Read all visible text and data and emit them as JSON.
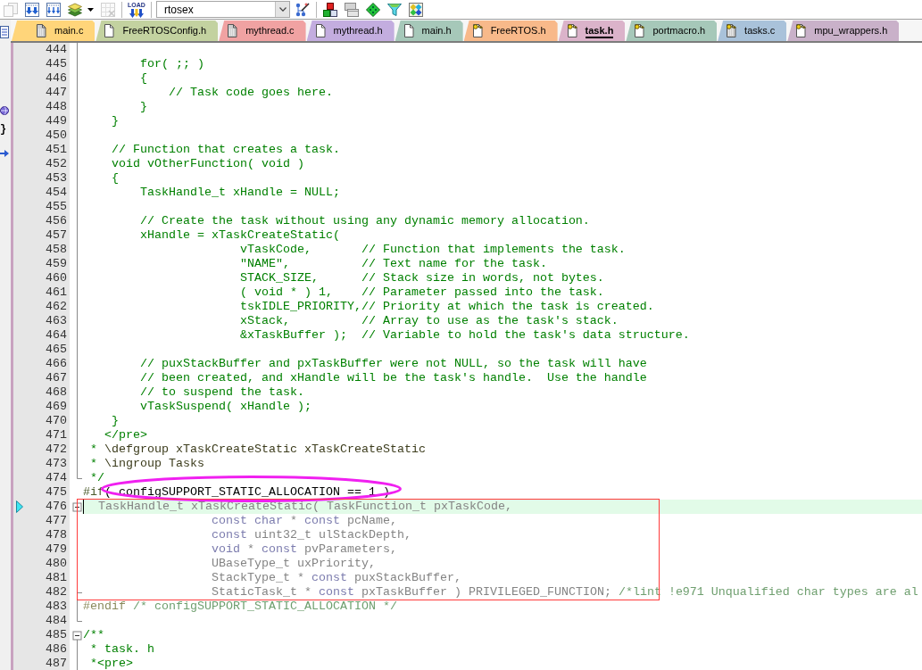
{
  "toolbar": [
    {
      "kind": "pages",
      "disabled": true
    },
    {
      "kind": "download",
      "disabled": false
    },
    {
      "kind": "download_all",
      "disabled": false
    },
    {
      "kind": "layers",
      "disabled": false
    },
    {
      "kind": "caret",
      "disabled": false
    },
    {
      "kind": "grid",
      "disabled": true
    },
    {
      "kind": "separator"
    },
    {
      "kind": "load",
      "label": "LOAD",
      "disabled": false
    },
    {
      "kind": "separator"
    },
    {
      "kind": "combo",
      "value": "rtosex"
    },
    {
      "kind": "wand",
      "disabled": false
    },
    {
      "kind": "separator"
    },
    {
      "kind": "blocks",
      "disabled": false
    },
    {
      "kind": "windows",
      "disabled": false
    },
    {
      "kind": "diamond",
      "disabled": false
    },
    {
      "kind": "funnel",
      "disabled": false
    },
    {
      "kind": "gems",
      "disabled": false
    }
  ],
  "side_toolbar": [
    {
      "kind": "window"
    },
    {
      "kind": "globe"
    },
    {
      "kind": "text",
      "label": "}"
    },
    {
      "kind": "arrow"
    }
  ],
  "tabs": [
    {
      "label": "main.c",
      "kind": "source",
      "read_only": false,
      "color": "#ffd57a",
      "selected": false
    },
    {
      "label": "FreeRTOSConfig.h",
      "kind": "header",
      "read_only": false,
      "color": "#c3d2a0",
      "selected": false
    },
    {
      "label": "mythread.c",
      "kind": "source",
      "read_only": false,
      "color": "#f0a2a2",
      "selected": false
    },
    {
      "label": "mythread.h",
      "kind": "header",
      "read_only": false,
      "color": "#c3addf",
      "selected": false
    },
    {
      "label": "main.h",
      "kind": "header",
      "read_only": false,
      "color": "#a6c8b9",
      "selected": false
    },
    {
      "label": "FreeRTOS.h",
      "kind": "header",
      "read_only": true,
      "color": "#f8b98a",
      "selected": false
    },
    {
      "label": "task.h",
      "kind": "header",
      "read_only": true,
      "color": "#dbb3ca",
      "selected": true
    },
    {
      "label": "portmacro.h",
      "kind": "header",
      "read_only": true,
      "color": "#a6c8b9",
      "selected": false
    },
    {
      "label": "tasks.c",
      "kind": "source",
      "read_only": true,
      "color": "#a9c2da",
      "selected": false
    },
    {
      "label": "mpu_wrappers.h",
      "kind": "header",
      "read_only": true,
      "color": "#c9b1c9",
      "selected": false
    }
  ],
  "lines": [
    {
      "number": "444",
      "current": false,
      "marker": false,
      "fold": {
        "kind": "body"
      }
    },
    {
      "number": "445",
      "current": false,
      "marker": false,
      "fold": {
        "kind": "body"
      },
      "parts": [
        {
          "text": "        for( ;; )",
          "kind": "comment"
        }
      ]
    },
    {
      "number": "446",
      "current": false,
      "marker": false,
      "fold": {
        "kind": "body"
      },
      "parts": [
        {
          "text": "        {",
          "kind": "comment"
        }
      ]
    },
    {
      "number": "447",
      "current": false,
      "marker": false,
      "fold": {
        "kind": "body"
      },
      "parts": [
        {
          "text": "            // Task code goes here.",
          "kind": "comment"
        }
      ]
    },
    {
      "number": "448",
      "current": false,
      "marker": false,
      "fold": {
        "kind": "body"
      },
      "parts": [
        {
          "text": "        }",
          "kind": "comment"
        }
      ]
    },
    {
      "number": "449",
      "current": false,
      "marker": false,
      "fold": {
        "kind": "body"
      },
      "parts": [
        {
          "text": "    }",
          "kind": "comment"
        }
      ]
    },
    {
      "number": "450",
      "current": false,
      "marker": false,
      "fold": {
        "kind": "body"
      }
    },
    {
      "number": "451",
      "current": false,
      "marker": false,
      "fold": {
        "kind": "body"
      },
      "parts": [
        {
          "text": "    // Function that creates a task.",
          "kind": "comment"
        }
      ]
    },
    {
      "number": "452",
      "current": false,
      "marker": false,
      "fold": {
        "kind": "body"
      },
      "parts": [
        {
          "text": "    void vOtherFunction( void )",
          "kind": "comment"
        }
      ]
    },
    {
      "number": "453",
      "current": false,
      "marker": false,
      "fold": {
        "kind": "body"
      },
      "parts": [
        {
          "text": "    {",
          "kind": "comment"
        }
      ]
    },
    {
      "number": "454",
      "current": false,
      "marker": false,
      "fold": {
        "kind": "body"
      },
      "parts": [
        {
          "text": "        TaskHandle_t xHandle = NULL;",
          "kind": "comment"
        }
      ]
    },
    {
      "number": "455",
      "current": false,
      "marker": false,
      "fold": {
        "kind": "body"
      }
    },
    {
      "number": "456",
      "current": false,
      "marker": false,
      "fold": {
        "kind": "body"
      },
      "parts": [
        {
          "text": "        // Create the task without using any dynamic memory allocation.",
          "kind": "comment"
        }
      ]
    },
    {
      "number": "457",
      "current": false,
      "marker": false,
      "fold": {
        "kind": "body"
      },
      "parts": [
        {
          "text": "        xHandle = xTaskCreateStatic(",
          "kind": "comment"
        }
      ]
    },
    {
      "number": "458",
      "current": false,
      "marker": false,
      "fold": {
        "kind": "body"
      },
      "parts": [
        {
          "text": "                      vTaskCode,       // Function that implements the task.",
          "kind": "comment"
        }
      ]
    },
    {
      "number": "459",
      "current": false,
      "marker": false,
      "fold": {
        "kind": "body"
      },
      "parts": [
        {
          "text": "                      \"NAME\",          // Text name for the task.",
          "kind": "comment"
        }
      ]
    },
    {
      "number": "460",
      "current": false,
      "marker": false,
      "fold": {
        "kind": "body"
      },
      "parts": [
        {
          "text": "                      STACK_SIZE,      // Stack size in words, not bytes.",
          "kind": "comment"
        }
      ]
    },
    {
      "number": "461",
      "current": false,
      "marker": false,
      "fold": {
        "kind": "body"
      },
      "parts": [
        {
          "text": "                      ( void * ) 1,    // Parameter passed into the task.",
          "kind": "comment"
        }
      ]
    },
    {
      "number": "462",
      "current": false,
      "marker": false,
      "fold": {
        "kind": "body"
      },
      "parts": [
        {
          "text": "                      tskIDLE_PRIORITY,// Priority at which the task is created.",
          "kind": "comment"
        }
      ]
    },
    {
      "number": "463",
      "current": false,
      "marker": false,
      "fold": {
        "kind": "body"
      },
      "parts": [
        {
          "text": "                      xStack,          // Array to use as the task's stack.",
          "kind": "comment"
        }
      ]
    },
    {
      "number": "464",
      "current": false,
      "marker": false,
      "fold": {
        "kind": "body"
      },
      "parts": [
        {
          "text": "                      &xTaskBuffer );  // Variable to hold the task's data structure.",
          "kind": "comment"
        }
      ]
    },
    {
      "number": "465",
      "current": false,
      "marker": false,
      "fold": {
        "kind": "body"
      }
    },
    {
      "number": "466",
      "current": false,
      "marker": false,
      "fold": {
        "kind": "body"
      },
      "parts": [
        {
          "text": "        // puxStackBuffer and pxTaskBuffer were not NULL, so the task will have",
          "kind": "comment"
        }
      ]
    },
    {
      "number": "467",
      "current": false,
      "marker": false,
      "fold": {
        "kind": "body"
      },
      "parts": [
        {
          "text": "        // been created, and xHandle will be the task's handle.  Use the handle",
          "kind": "comment"
        }
      ]
    },
    {
      "number": "468",
      "current": false,
      "marker": false,
      "fold": {
        "kind": "body"
      },
      "parts": [
        {
          "text": "        // to suspend the task.",
          "kind": "comment"
        }
      ]
    },
    {
      "number": "469",
      "current": false,
      "marker": false,
      "fold": {
        "kind": "body"
      },
      "parts": [
        {
          "text": "        vTaskSuspend( xHandle );",
          "kind": "comment"
        }
      ]
    },
    {
      "number": "470",
      "current": false,
      "marker": false,
      "fold": {
        "kind": "body"
      },
      "parts": [
        {
          "text": "    }",
          "kind": "comment"
        }
      ]
    },
    {
      "number": "471",
      "current": false,
      "marker": false,
      "fold": {
        "kind": "body"
      },
      "parts": [
        {
          "text": "   </pre>",
          "kind": "comment"
        }
      ]
    },
    {
      "number": "472",
      "current": false,
      "marker": false,
      "fold": {
        "kind": "body"
      },
      "parts": [
        {
          "text": " * ",
          "kind": "comment"
        },
        {
          "text": "\\defgroup xTaskCreateStatic xTaskCreateStatic",
          "kind": "doc"
        }
      ]
    },
    {
      "number": "473",
      "current": false,
      "marker": false,
      "fold": {
        "kind": "body"
      },
      "parts": [
        {
          "text": " * ",
          "kind": "comment"
        },
        {
          "text": "\\ingroup Tasks",
          "kind": "doc"
        }
      ]
    },
    {
      "number": "474",
      "current": false,
      "marker": false,
      "fold": {
        "kind": "end"
      },
      "parts": [
        {
          "text": " */",
          "kind": "comment"
        }
      ]
    },
    {
      "number": "475",
      "current": false,
      "marker": false,
      "parts": [
        {
          "text": "#if",
          "kind": "directive"
        },
        {
          "text": "( configSUPPORT_STATIC_ALLOCATION == 1 )",
          "kind": "code"
        }
      ]
    },
    {
      "number": "476",
      "current": true,
      "marker": true,
      "fold": {
        "kind": "start"
      },
      "parts": [
        {
          "text": "  TaskHandle_t xTaskCreateStatic( TaskFunction_t pxTaskCode,",
          "kind": "inactive"
        }
      ]
    },
    {
      "number": "477",
      "current": false,
      "marker": false,
      "fold": {
        "kind": "body"
      },
      "parts": [
        {
          "text": "                  const char",
          "kind": "inactive_keyword"
        },
        {
          "text": " * ",
          "kind": "inactive"
        },
        {
          "text": "const",
          "kind": "inactive_keyword"
        },
        {
          "text": " pcName,",
          "kind": "inactive"
        }
      ]
    },
    {
      "number": "478",
      "current": false,
      "marker": false,
      "fold": {
        "kind": "body"
      },
      "parts": [
        {
          "text": "                  const",
          "kind": "inactive_keyword"
        },
        {
          "text": " uint32_t ulStackDepth,",
          "kind": "inactive"
        }
      ]
    },
    {
      "number": "479",
      "current": false,
      "marker": false,
      "fold": {
        "kind": "body"
      },
      "parts": [
        {
          "text": "                  void",
          "kind": "inactive_keyword"
        },
        {
          "text": " * ",
          "kind": "inactive"
        },
        {
          "text": "const",
          "kind": "inactive_keyword"
        },
        {
          "text": " pvParameters,",
          "kind": "inactive"
        }
      ]
    },
    {
      "number": "480",
      "current": false,
      "marker": false,
      "fold": {
        "kind": "body"
      },
      "parts": [
        {
          "text": "                  UBaseType_t uxPriority,",
          "kind": "inactive"
        }
      ]
    },
    {
      "number": "481",
      "current": false,
      "marker": false,
      "fold": {
        "kind": "body"
      },
      "parts": [
        {
          "text": "                  StackType_t * ",
          "kind": "inactive"
        },
        {
          "text": "const",
          "kind": "inactive_keyword"
        },
        {
          "text": " puxStackBuffer,",
          "kind": "inactive"
        }
      ]
    },
    {
      "number": "482",
      "current": false,
      "marker": false,
      "fold": {
        "kind": "branch"
      },
      "parts": [
        {
          "text": "                  StaticTask_t * ",
          "kind": "inactive"
        },
        {
          "text": "const",
          "kind": "inactive_keyword"
        },
        {
          "text": " pxTaskBuffer ) PRIVILEGED_FUNCTION; ",
          "kind": "inactive"
        },
        {
          "text": "/*lint !e971 Unqualified char types are al",
          "kind": "inactive_comment"
        }
      ]
    },
    {
      "number": "483",
      "current": false,
      "marker": false,
      "fold": {
        "kind": "body"
      },
      "parts": [
        {
          "text": "#endif",
          "kind": "inactive_directive"
        },
        {
          "text": " /* configSUPPORT_STATIC_ALLOCATION */",
          "kind": "inactive_comment"
        }
      ]
    },
    {
      "number": "484",
      "current": false,
      "marker": false,
      "fold": {
        "kind": "end"
      }
    },
    {
      "number": "485",
      "current": false,
      "marker": false,
      "fold": {
        "kind": "start"
      },
      "parts": [
        {
          "text": "/**",
          "kind": "comment"
        }
      ]
    },
    {
      "number": "486",
      "current": false,
      "marker": false,
      "fold": {
        "kind": "body"
      },
      "parts": [
        {
          "text": " * task. h",
          "kind": "comment"
        }
      ]
    },
    {
      "number": "487",
      "current": false,
      "marker": false,
      "fold": {
        "kind": "body"
      },
      "parts": [
        {
          "text": " *<pre>",
          "kind": "comment"
        }
      ]
    }
  ],
  "annotations": [
    {
      "kind": "ellipse",
      "color": "#f020f0"
    },
    {
      "kind": "rectangle",
      "color": "#ff3b3b"
    }
  ]
}
